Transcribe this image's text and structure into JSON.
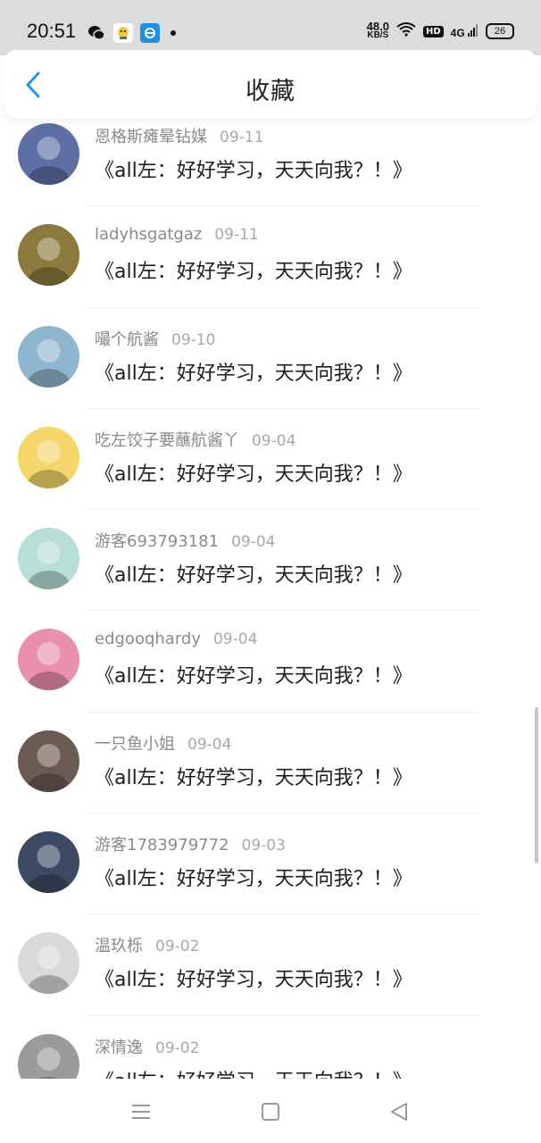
{
  "status_bar": {
    "time": "20:51",
    "net_speed_value": "48.0",
    "net_speed_unit": "KB/S",
    "hd": "HD",
    "signal": "4G",
    "battery": "26",
    "app_icons": [
      "wechat-icon",
      "cartoon-app-icon",
      "browser-icon"
    ]
  },
  "header": {
    "title": "收藏",
    "back_icon": "chevron-left-icon"
  },
  "items": [
    {
      "name": "恩格斯瘫晕钻媒",
      "date": "09-11",
      "content": "《all左：好好学习，天天向我？！》",
      "avatar_color": "#5d6fa5"
    },
    {
      "name": "ladyhsgatgaz",
      "date": "09-11",
      "content": "《all左：好好学习，天天向我？！》",
      "avatar_color": "#8a7a3c"
    },
    {
      "name": "嘬个航酱",
      "date": "09-10",
      "content": "《all左：好好学习，天天向我？！》",
      "avatar_color": "#8fb6cf"
    },
    {
      "name": "吃左饺子要蘸航酱丫",
      "date": "09-04",
      "content": "《all左：好好学习，天天向我？！》",
      "avatar_color": "#f5d66b"
    },
    {
      "name": "游客693793181",
      "date": "09-04",
      "content": "《all左：好好学习，天天向我？！》",
      "avatar_color": "#b7dfd7"
    },
    {
      "name": "edgooqhardy",
      "date": "09-04",
      "content": "《all左：好好学习，天天向我？！》",
      "avatar_color": "#e98fb0"
    },
    {
      "name": "一只鱼小姐",
      "date": "09-04",
      "content": "《all左：好好学习，天天向我？！》",
      "avatar_color": "#6b5a52"
    },
    {
      "name": "游客1783979772",
      "date": "09-03",
      "content": "《all左：好好学习，天天向我？！》",
      "avatar_color": "#3c4a63"
    },
    {
      "name": "温玖栎",
      "date": "09-02",
      "content": "《all左：好好学习，天天向我？！》",
      "avatar_color": "#d9d9d9"
    },
    {
      "name": "深情逸",
      "date": "09-02",
      "content": "《all左：好好学习，天天向我？！》",
      "avatar_color": "#9b9b9b"
    }
  ],
  "nav": {
    "menu_icon": "menu-icon",
    "home_icon": "square-home-icon",
    "back_icon": "triangle-back-icon"
  },
  "colors": {
    "accent": "#1a9bf0",
    "status_bar_bg": "#dcdcdc",
    "meta_text": "#8a8a8a",
    "content_text": "#1d1d1d"
  }
}
